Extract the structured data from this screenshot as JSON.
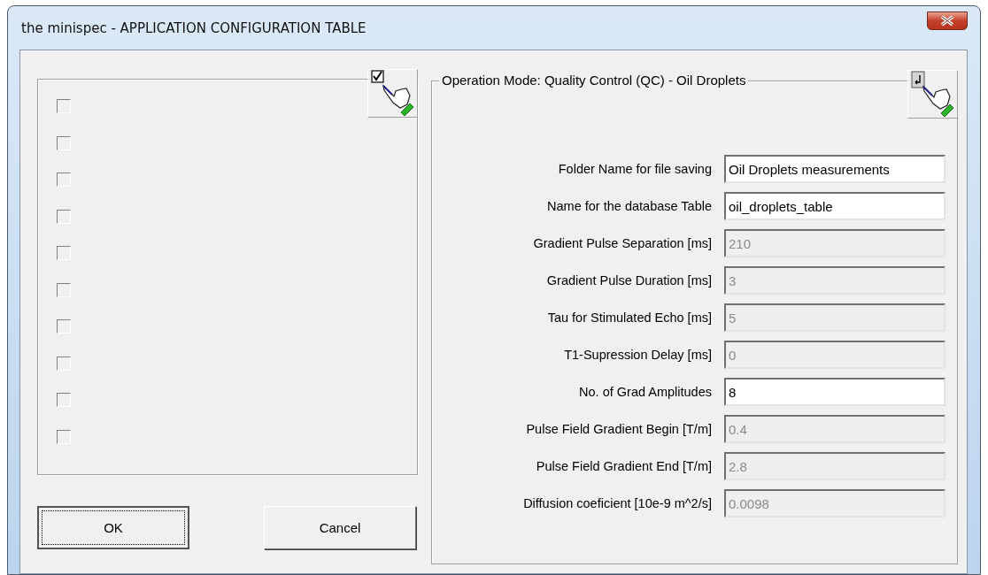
{
  "window": {
    "title": "the minispec - APPLICATION CONFIGURATION TABLE"
  },
  "left_panel": {
    "checkboxes": [
      {
        "checked": false
      },
      {
        "checked": false
      },
      {
        "checked": false
      },
      {
        "checked": false
      },
      {
        "checked": false
      },
      {
        "checked": false
      },
      {
        "checked": false
      },
      {
        "checked": false
      },
      {
        "checked": false
      },
      {
        "checked": false
      }
    ]
  },
  "right_panel": {
    "title": "Operation Mode: Quality Control (QC) - Oil Droplets",
    "fields": [
      {
        "label": "Folder Name for file saving",
        "value": "Oil Droplets measurements",
        "disabled": false
      },
      {
        "label": "Name for the database Table",
        "value": "oil_droplets_table",
        "disabled": false
      },
      {
        "label": "Gradient Pulse Separation [ms]",
        "value": "210",
        "disabled": true
      },
      {
        "label": "Gradient Pulse Duration [ms]",
        "value": "3",
        "disabled": true
      },
      {
        "label": "Tau for Stimulated Echo [ms]",
        "value": "5",
        "disabled": true
      },
      {
        "label": "T1-Supression Delay [ms]",
        "value": "0",
        "disabled": true
      },
      {
        "label": "No. of Grad Amplitudes",
        "value": "8",
        "disabled": false
      },
      {
        "label": "Pulse Field Gradient Begin [T/m]",
        "value": "0.4",
        "disabled": true
      },
      {
        "label": "Pulse Field Gradient End [T/m]",
        "value": "2.8",
        "disabled": true
      },
      {
        "label": "Diffusion coeficient [10e-9 m^2/s]",
        "value": "0.0098",
        "disabled": true
      }
    ]
  },
  "buttons": [
    {
      "label": "OK",
      "kind": "default"
    },
    {
      "label": "Cancel",
      "kind": "normal"
    }
  ]
}
